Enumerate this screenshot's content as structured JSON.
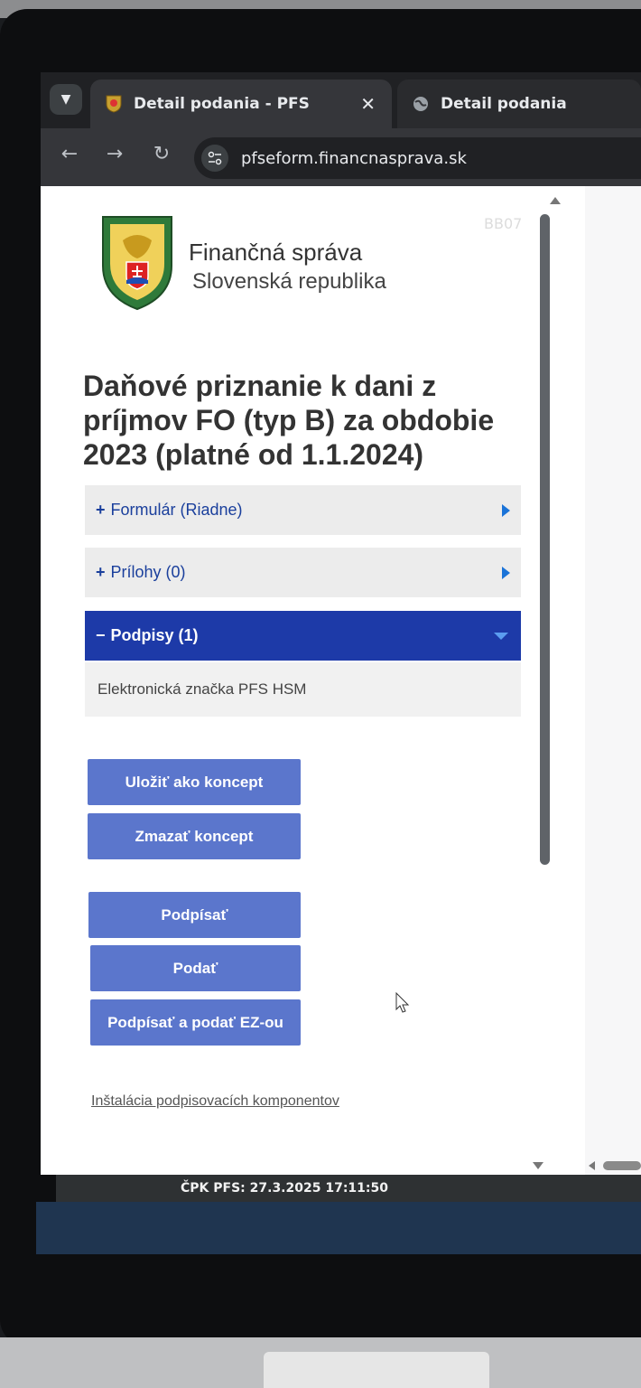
{
  "browser": {
    "tabs": [
      {
        "title": "Detail podania - PFS",
        "active": true
      },
      {
        "title": "Detail podania",
        "active": false
      }
    ],
    "url": "pfseform.financnasprava.sk"
  },
  "header": {
    "code": "BB07",
    "org_name": "Finančná správa",
    "org_country": "Slovenská republika"
  },
  "form": {
    "title": "Daňové priznanie k dani z príjmov FO (typ B) za obdobie 2023 (platné od 1.1.2024)"
  },
  "sections": [
    {
      "label": "Formulár (Riadne)",
      "sign": "+",
      "expanded": false
    },
    {
      "label": "Prílohy (0)",
      "sign": "+",
      "expanded": false
    },
    {
      "label": "Podpisy (1)",
      "sign": "−",
      "expanded": true
    }
  ],
  "signature_item": "Elektronická značka PFS HSM",
  "buttons": {
    "save_draft": "Uložiť ako koncept",
    "delete_draft": "Zmazať koncept",
    "sign": "Podpísať",
    "submit": "Podať",
    "sign_submit": "Podpísať a podať EZ-ou"
  },
  "links": {
    "install_components": "Inštalácia podpisovacích komponentov"
  },
  "status": {
    "text": "ČPK PFS: 27.3.2025 17:11:50"
  },
  "colors": {
    "accent": "#1d3aa8",
    "button": "#5b76cc"
  }
}
